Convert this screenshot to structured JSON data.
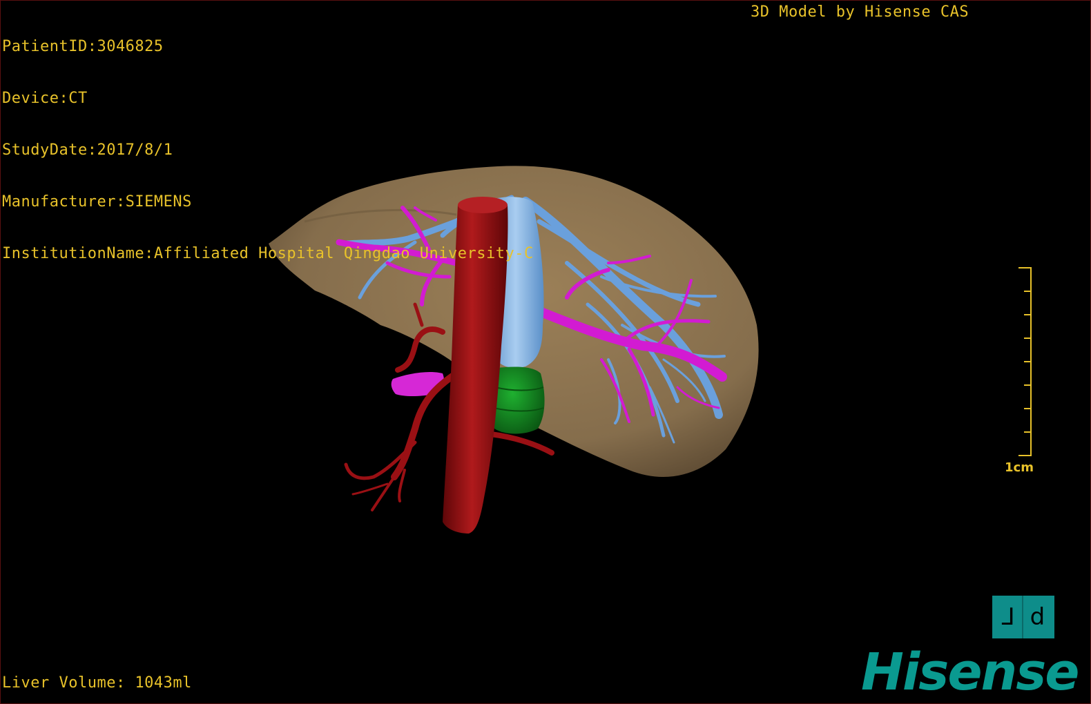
{
  "header": {
    "patient_id": "PatientID:3046825",
    "device": "Device:CT",
    "study_date": "StudyDate:2017/8/1",
    "manufacturer": "Manufacturer:SIEMENS",
    "institution": "InstitutionName:Affiliated Hospital Qingdao University-C",
    "credit": "3D Model by Hisense CAS"
  },
  "footer": {
    "liver_volume": "Liver Volume: 1043ml"
  },
  "scale": {
    "label": "1cm"
  },
  "orientation_cube": {
    "left_glyph": "⅃",
    "right_glyph": "d"
  },
  "brand": {
    "name": "Hisense",
    "color": "#0a9a90"
  },
  "colors": {
    "overlay_text": "#e8c22a",
    "liver": "#8b7352",
    "artery": "#8c0d10",
    "portal_vein": "#6aa0dc",
    "hepatic_vein": "#d21bd2",
    "gallbladder": "#118a1e"
  }
}
